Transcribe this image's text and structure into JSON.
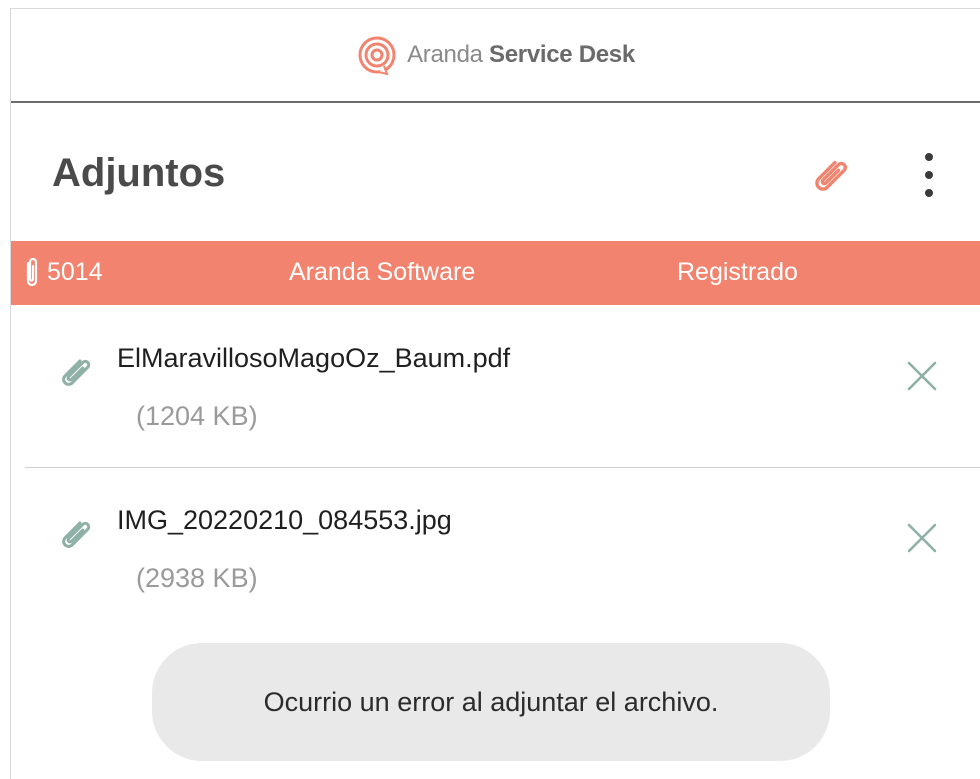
{
  "app": {
    "brand_name_light": "Aranda ",
    "brand_name_bold": "Service Desk",
    "brand_color": "#f2836e"
  },
  "screen": {
    "title": "Adjuntos",
    "attach_icon": "paperclip-icon",
    "menu_icon": "more-vertical-icon"
  },
  "case": {
    "id": "5014",
    "company": "Aranda Software",
    "status": "Registrado",
    "bar_color": "#f2836e"
  },
  "attachments": [
    {
      "name": "ElMaravillosoMagoOz_Baum.pdf",
      "size": "(1204 KB)"
    },
    {
      "name": "IMG_20220210_084553.jpg",
      "size": "(2938 KB)"
    }
  ],
  "toast": {
    "message": "Ocurrio un error al adjuntar el archivo."
  }
}
